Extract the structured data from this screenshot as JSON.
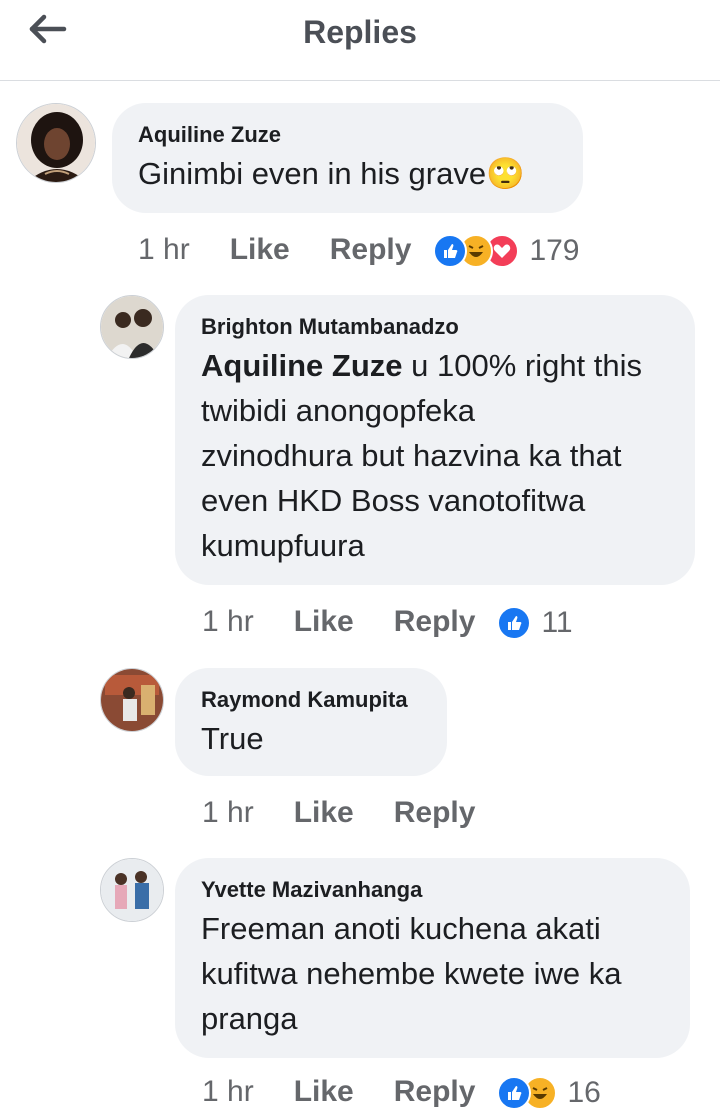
{
  "header": {
    "title": "Replies"
  },
  "comments": [
    {
      "author": "Aquiline Zuze",
      "text": "Ginimbi even in his grave",
      "emoji": "🙄",
      "time": "1 hr",
      "like_label": "Like",
      "reply_label": "Reply",
      "reactions": [
        "like-icon",
        "haha-icon",
        "love-icon"
      ],
      "reaction_count": "179"
    },
    {
      "author": "Brighton Mutambanadzo",
      "mention": "Aquiline Zuze",
      "text_lines": [
        " u 100% right this",
        "twibidi anongopfeka",
        "zvinodhura but hazvina ka that",
        "even HKD Boss vanotofitwa",
        "kumupfuura"
      ],
      "time": "1 hr",
      "like_label": "Like",
      "reply_label": "Reply",
      "reactions": [
        "like-icon"
      ],
      "reaction_count": "11"
    },
    {
      "author": "Raymond Kamupita",
      "text": "True",
      "time": "1 hr",
      "like_label": "Like",
      "reply_label": "Reply"
    },
    {
      "author": "Yvette Mazivanhanga",
      "text_lines": [
        "Freeman anoti kuchena akati",
        "kufitwa nehembe kwete iwe ka",
        "pranga"
      ],
      "time": "1 hr",
      "like_label": "Like",
      "reply_label": "Reply",
      "reactions": [
        "like-icon",
        "haha-icon"
      ],
      "reaction_count": "16"
    }
  ],
  "colors": {
    "like": "#1877f2",
    "haha": "#f7b125",
    "love": "#f33e58",
    "bubble": "#f0f2f5",
    "meta": "#65676b"
  }
}
